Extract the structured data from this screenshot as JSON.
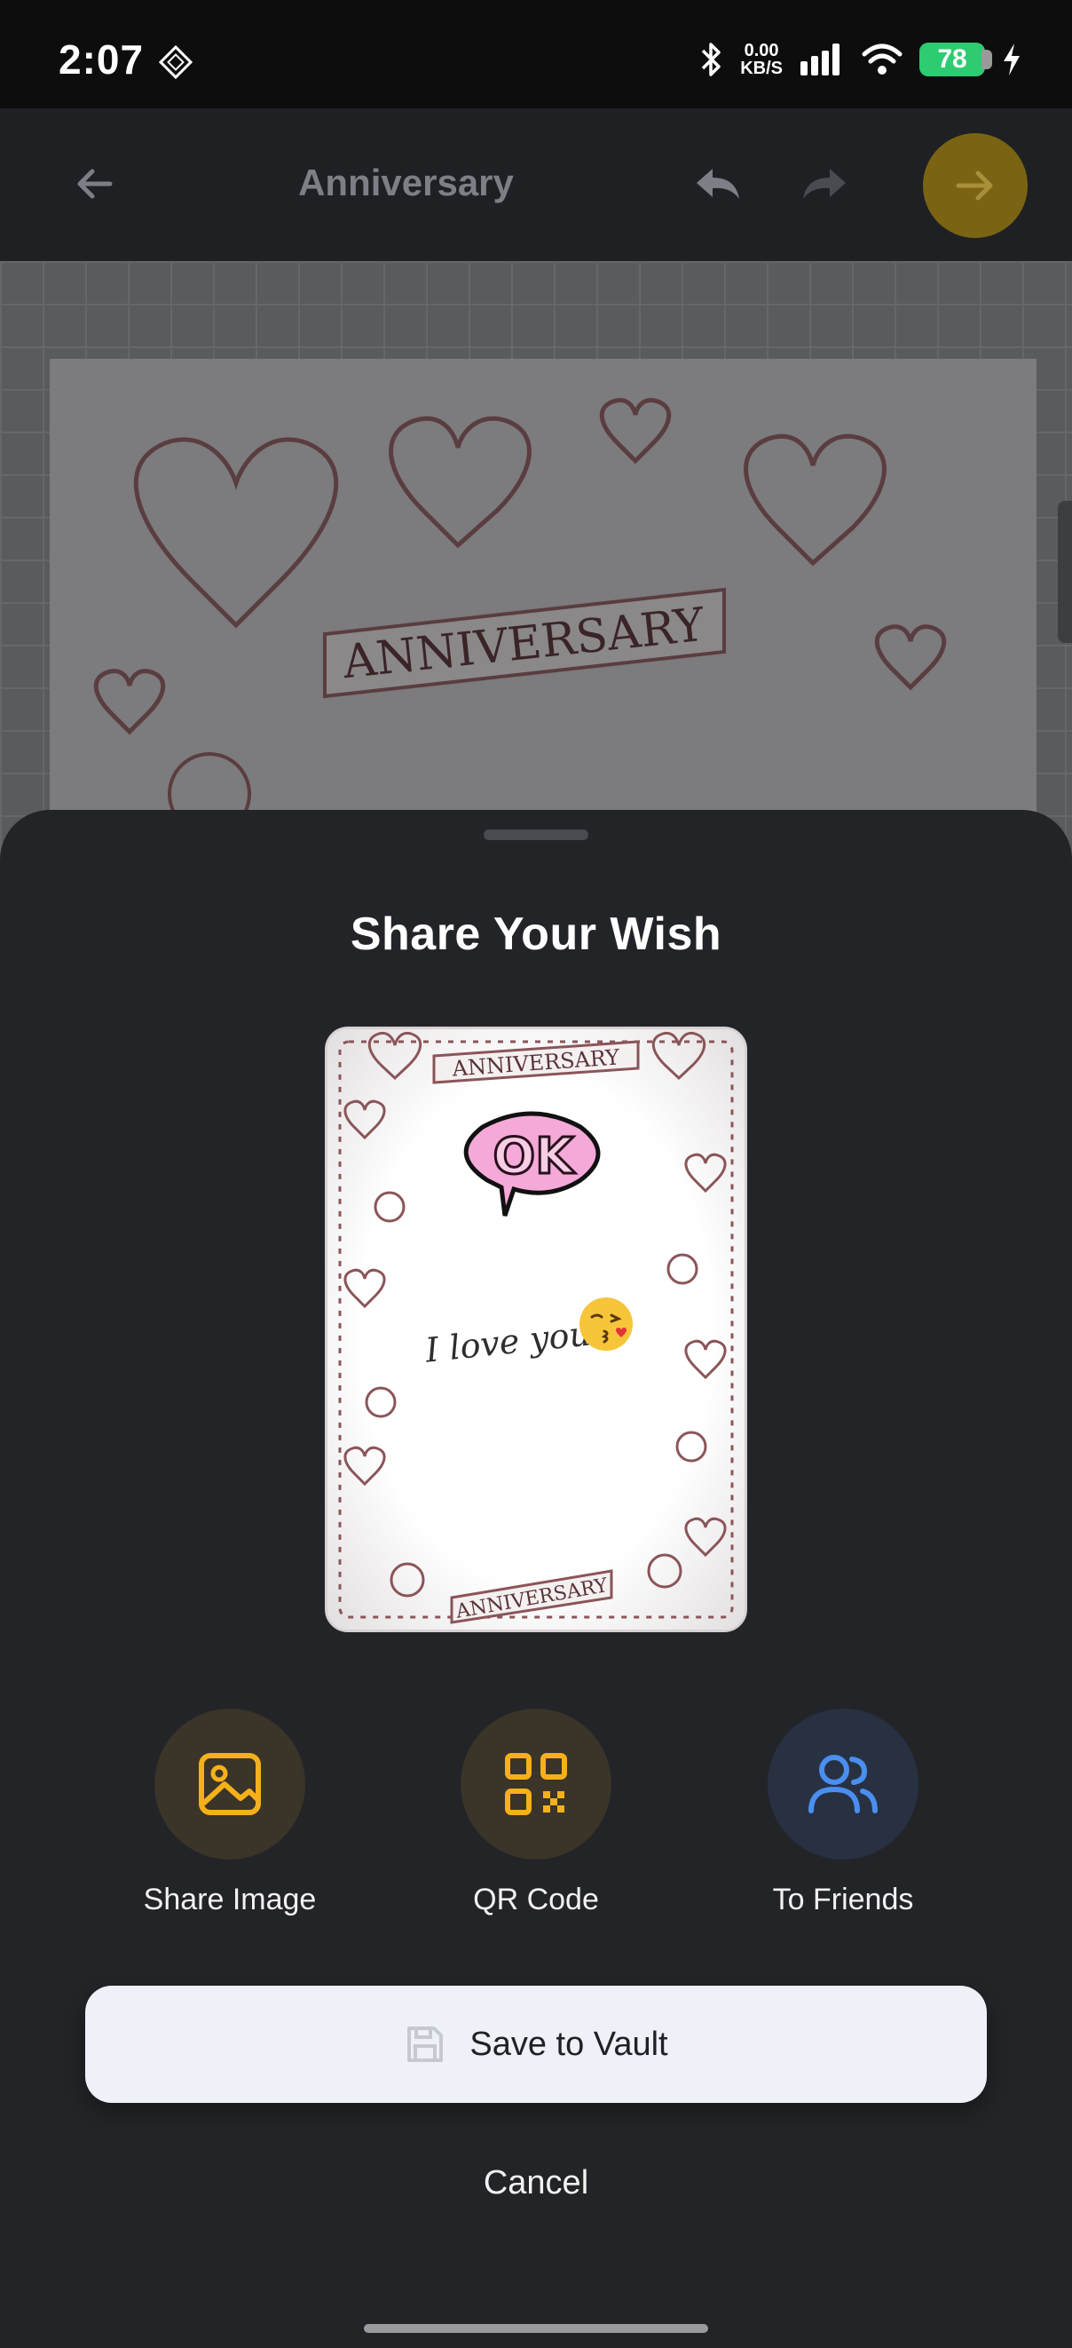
{
  "status_bar": {
    "time": "2:07",
    "net_speed_top": "0.00",
    "net_speed_bottom": "KB/S",
    "battery": "78"
  },
  "header": {
    "title": "Anniversary"
  },
  "canvas": {
    "banner_text": "ANNIVERSARY"
  },
  "sheet": {
    "title": "Share Your Wish",
    "preview": {
      "banner_top": "ANNIVERSARY",
      "banner_bottom": "ANNIVERSARY",
      "sticker_text": "OK",
      "message": "I love you"
    },
    "actions": [
      {
        "label": "Share Image",
        "icon": "image-icon",
        "color": "#f5b01a"
      },
      {
        "label": "QR Code",
        "icon": "qr-code-icon",
        "color": "#f5b01a"
      },
      {
        "label": "To Friends",
        "icon": "users-icon",
        "color": "#4a8ef0"
      }
    ],
    "save_label": "Save to Vault",
    "cancel_label": "Cancel"
  },
  "colors": {
    "accent": "#f5b01a",
    "sheet_bg": "#232428",
    "primary_button_bg": "#eef1f8"
  }
}
